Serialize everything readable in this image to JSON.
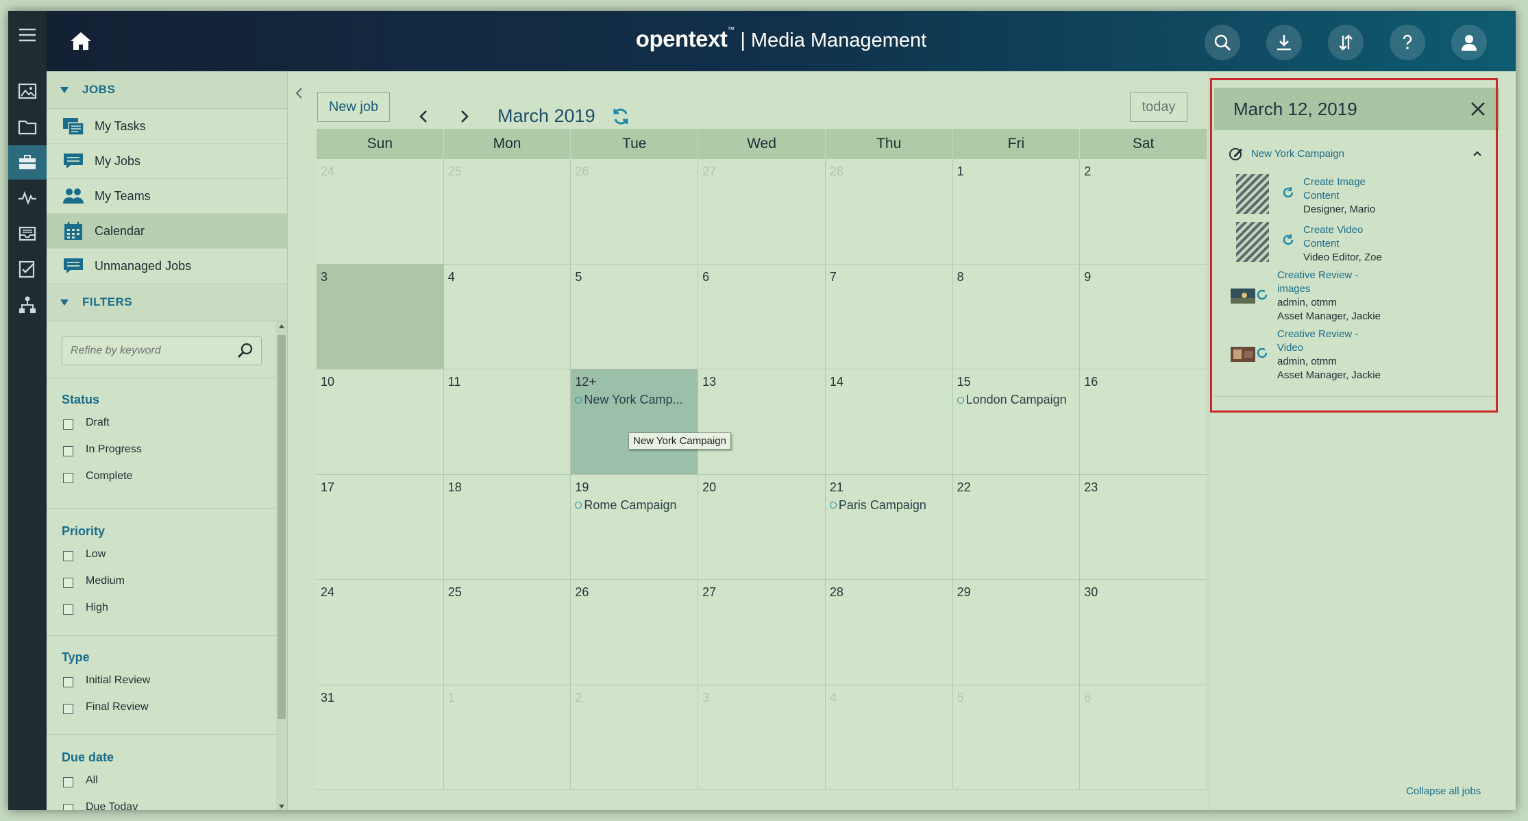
{
  "header": {
    "brand_logo": "opentext",
    "brand_tm": "™",
    "brand_sep": "|",
    "brand_product": "Media Management"
  },
  "rail_icons": [
    "menu-icon",
    "image-icon",
    "folder-icon",
    "briefcase-icon",
    "activity-icon",
    "inbox-icon",
    "checklist-icon",
    "hierarchy-icon"
  ],
  "sidebar": {
    "jobs_heading": "JOBS",
    "nav": [
      {
        "label": "My Tasks",
        "icon": "tasks-icon"
      },
      {
        "label": "My Jobs",
        "icon": "jobs-icon"
      },
      {
        "label": "My Teams",
        "icon": "teams-icon"
      },
      {
        "label": "Calendar",
        "icon": "calendar-icon",
        "active": true
      },
      {
        "label": "Unmanaged Jobs",
        "icon": "unmanaged-jobs-icon"
      }
    ],
    "filters_heading": "FILTERS",
    "search_placeholder": "Refine by keyword",
    "groups": [
      {
        "title": "Status",
        "options": [
          "Draft",
          "In Progress",
          "Complete"
        ]
      },
      {
        "title": "Priority",
        "options": [
          "Low",
          "Medium",
          "High"
        ]
      },
      {
        "title": "Type",
        "options": [
          "Initial Review",
          "Final Review"
        ]
      },
      {
        "title": "Due date",
        "options": [
          "All",
          "Due Today"
        ]
      }
    ]
  },
  "toolbar": {
    "new_job_label": "New job",
    "month_title": "March 2019",
    "today_label": "today"
  },
  "calendar": {
    "weekdays": [
      "Sun",
      "Mon",
      "Tue",
      "Wed",
      "Thu",
      "Fri",
      "Sat"
    ],
    "weeks": [
      [
        {
          "d": "24",
          "o": true
        },
        {
          "d": "25",
          "o": true
        },
        {
          "d": "26",
          "o": true
        },
        {
          "d": "27",
          "o": true
        },
        {
          "d": "28",
          "o": true
        },
        {
          "d": "1"
        },
        {
          "d": "2"
        }
      ],
      [
        {
          "d": "3",
          "today": true
        },
        {
          "d": "4"
        },
        {
          "d": "5"
        },
        {
          "d": "6"
        },
        {
          "d": "7"
        },
        {
          "d": "8"
        },
        {
          "d": "9"
        }
      ],
      [
        {
          "d": "10"
        },
        {
          "d": "11"
        },
        {
          "d": "12+",
          "sel": true,
          "event": "New York Camp..."
        },
        {
          "d": "13"
        },
        {
          "d": "14"
        },
        {
          "d": "15",
          "event": "London Campaign"
        },
        {
          "d": "16"
        }
      ],
      [
        {
          "d": "17"
        },
        {
          "d": "18"
        },
        {
          "d": "19",
          "event": "Rome Campaign"
        },
        {
          "d": "20"
        },
        {
          "d": "21",
          "event": "Paris Campaign"
        },
        {
          "d": "22"
        },
        {
          "d": "23"
        }
      ],
      [
        {
          "d": "24"
        },
        {
          "d": "25"
        },
        {
          "d": "26"
        },
        {
          "d": "27"
        },
        {
          "d": "28"
        },
        {
          "d": "29"
        },
        {
          "d": "30"
        }
      ],
      [
        {
          "d": "31"
        },
        {
          "d": "1",
          "o": true
        },
        {
          "d": "2",
          "o": true
        },
        {
          "d": "3",
          "o": true
        },
        {
          "d": "4",
          "o": true
        },
        {
          "d": "5",
          "o": true
        },
        {
          "d": "6",
          "o": true
        }
      ]
    ],
    "tooltip": "New York Campaign"
  },
  "day_panel": {
    "title": "March 12, 2019",
    "campaign": "New York Campaign",
    "tasks": [
      {
        "line1": "Create Image",
        "line2": "Content",
        "assignee": "Designer, Mario"
      },
      {
        "line1": "Create Video",
        "line2": "Content",
        "assignee": "Video Editor, Zoe"
      },
      {
        "line1": "Creative Review -",
        "line2": "images",
        "assignee": "admin, otmm",
        "assignee2": "Asset Manager, Jackie"
      },
      {
        "line1": "Creative Review -",
        "line2": "Video",
        "assignee": "admin, otmm",
        "assignee2": "Asset Manager, Jackie"
      }
    ],
    "collapse_all": "Collapse all jobs"
  },
  "colors": {
    "accent": "#1a6d8c",
    "highlight_border": "#cc2a2a",
    "event_dot": "#1e88a8"
  }
}
